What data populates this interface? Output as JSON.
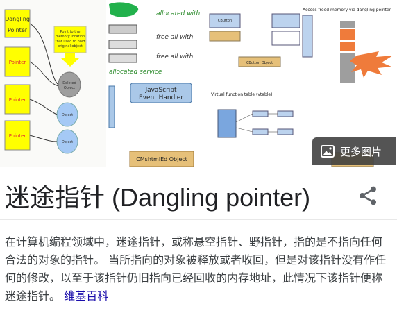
{
  "thumbnails": {
    "t1": {
      "boxes": [
        "Dangling Pointer",
        "Pointer",
        "Pointer",
        "Pointer"
      ],
      "callout": "Point to the memory location that used to hold original object",
      "deleted": "Deleted Object",
      "objects": [
        "Object",
        "Object"
      ]
    },
    "t2": {
      "notes": [
        "allocated with",
        "free all with",
        "free all with",
        "allocated service"
      ],
      "handler": "JavaScript Event Handler",
      "object": "CMshtmlEd Object"
    },
    "t3": {
      "top_boxes": [
        "CButton",
        "CButton",
        "CBut",
        "CBut"
      ],
      "mid_box": "CButton Object",
      "vtable_title": "Virtual function table (vtable)"
    },
    "t4": {
      "title": "Access freed memory via dangling pointer",
      "bottom": "CButton Object"
    }
  },
  "more_images": "更多图片",
  "title": "迷途指针 (Dangling pointer)",
  "description": {
    "text": "在计算机编程领域中，迷途指针，或称悬空指针、野指针，指的是不指向任何合法的对象的指针。 当所指向的对象被释放或者收回，但是对该指针没有作任何的修改，以至于该指针仍旧指向已经回收的内存地址，此情况下该指针便称迷途指针。",
    "source": "维基百科"
  }
}
